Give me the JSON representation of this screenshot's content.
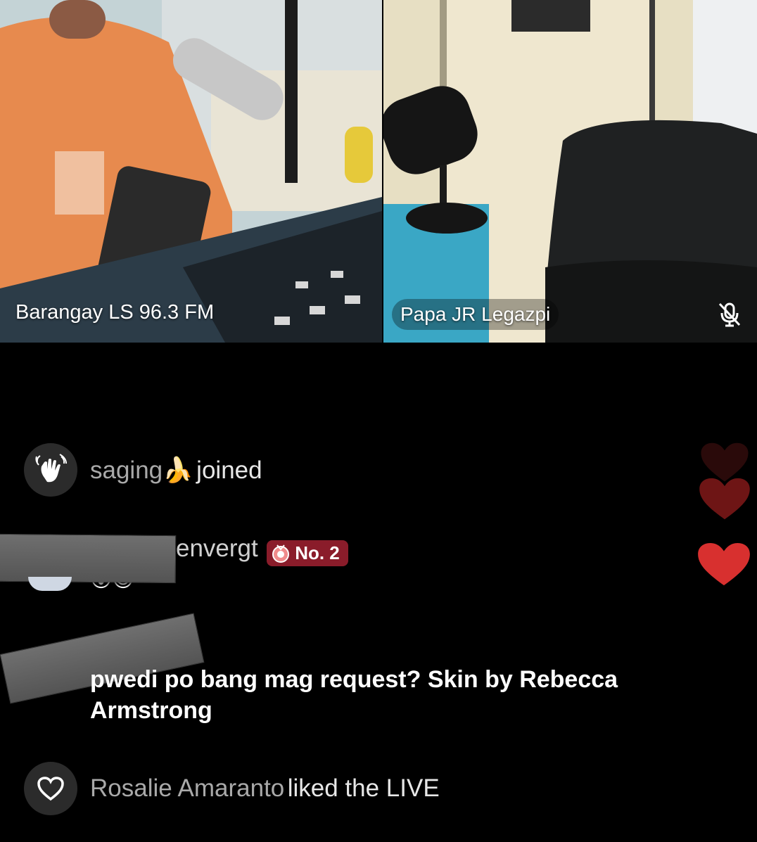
{
  "tiles": [
    {
      "label": "Barangay LS 96.3 FM"
    },
    {
      "label": "Papa JR Legazpi",
      "status_icon": "mic-off-icon"
    }
  ],
  "chat": {
    "joined": {
      "user": "saging🍌",
      "action": "joined",
      "icon": "wave-hand-icon"
    },
    "ranked": {
      "user": "envergt",
      "badge": "No. 2",
      "badge_icon": "medal-icon",
      "emoji": "😮😊"
    },
    "message": {
      "text": "pwedi po bang mag request? Skin by Rebecca Armstrong"
    },
    "liked": {
      "user": "Rosalie Amaranto",
      "action": "liked the LIVE",
      "icon": "heart-outline-icon"
    }
  },
  "colors": {
    "tile_highlight": "#2aa3c6",
    "badge_bg": "#8a1c2a",
    "heart_red": "#d8302f"
  }
}
